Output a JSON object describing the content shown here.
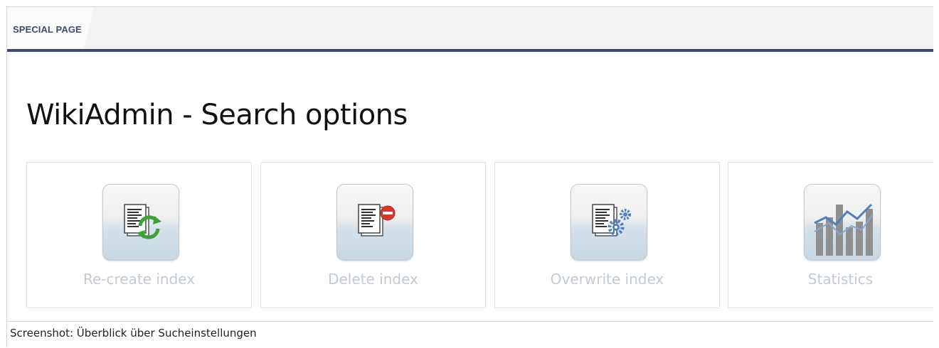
{
  "header": {
    "label": "SPECIAL PAGE"
  },
  "page": {
    "title": "WikiAdmin - Search options"
  },
  "cards": [
    {
      "label": "Re-create index",
      "icon": "document-refresh-icon"
    },
    {
      "label": "Delete index",
      "icon": "document-delete-icon"
    },
    {
      "label": "Overwrite index",
      "icon": "document-gears-icon"
    },
    {
      "label": "Statistics",
      "icon": "statistics-chart-icon"
    }
  ],
  "caption": "Screenshot: Überblick über Sucheinstellungen",
  "colors": {
    "header_rule": "#3e4a73",
    "header_label": "#3e4a6e",
    "card_label": "#c3cad2",
    "refresh_green": "#3aa335",
    "delete_red": "#d9362e",
    "gear_blue": "#4f7fc0"
  }
}
